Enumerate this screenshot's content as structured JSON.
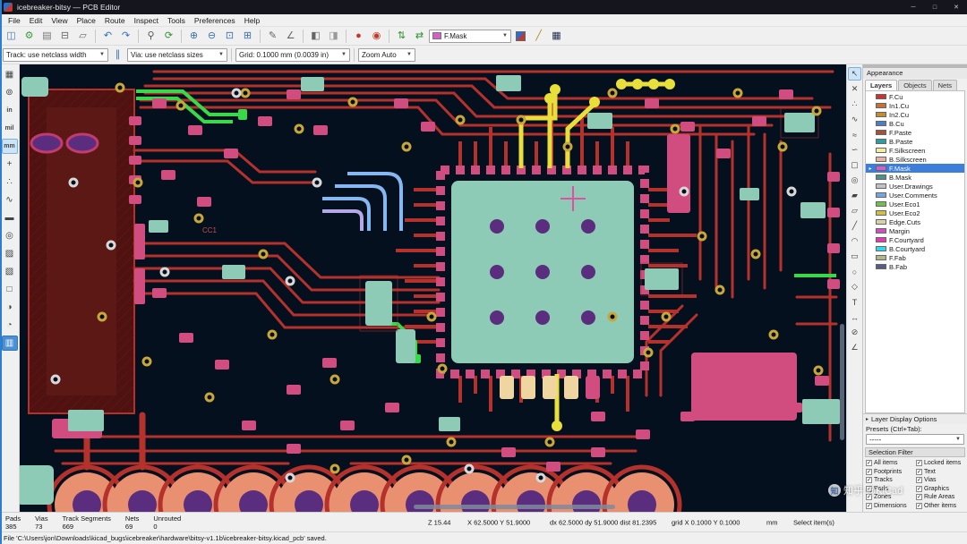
{
  "window": {
    "title": "icebreaker-bitsy — PCB Editor",
    "controls": {
      "minimize": "─",
      "maximize": "□",
      "close": "✕"
    }
  },
  "menu": {
    "items": [
      "File",
      "Edit",
      "View",
      "Place",
      "Route",
      "Inspect",
      "Tools",
      "Preferences",
      "Help"
    ]
  },
  "toolbar_top": {
    "items": [
      {
        "type": "btn",
        "name": "save",
        "icon": "save-icon",
        "glyph": "◫",
        "color": "#4a7ab5"
      },
      {
        "type": "btn",
        "name": "board-setup",
        "icon": "board-setup-gear-icon",
        "glyph": "⚙",
        "color": "#3f9b3f"
      },
      {
        "type": "btn",
        "name": "page-settings",
        "icon": "page-settings-icon",
        "glyph": "▤",
        "color": "#777777"
      },
      {
        "type": "btn",
        "name": "print",
        "icon": "printer-icon",
        "glyph": "⊟",
        "color": "#666666"
      },
      {
        "type": "btn",
        "name": "plot",
        "icon": "plot-icon",
        "glyph": "▱",
        "color": "#666666"
      },
      {
        "type": "sep"
      },
      {
        "type": "btn",
        "name": "undo",
        "icon": "undo-icon",
        "glyph": "↶",
        "color": "#2f6fb5"
      },
      {
        "type": "btn",
        "name": "redo",
        "icon": "redo-icon",
        "glyph": "↷",
        "color": "#2f6fb5"
      },
      {
        "type": "sep"
      },
      {
        "type": "btn",
        "name": "find",
        "icon": "search-icon",
        "glyph": "⚲",
        "color": "#555555"
      },
      {
        "type": "btn",
        "name": "refresh",
        "icon": "refresh-icon",
        "glyph": "⟳",
        "color": "#2f8f2f"
      },
      {
        "type": "sep"
      },
      {
        "type": "btn",
        "name": "zoom-in",
        "icon": "zoom-in-icon",
        "glyph": "⊕",
        "color": "#3a6fb0"
      },
      {
        "type": "btn",
        "name": "zoom-out",
        "icon": "zoom-out-icon",
        "glyph": "⊖",
        "color": "#3a6fb0"
      },
      {
        "type": "btn",
        "name": "zoom-fit",
        "icon": "zoom-fit-icon",
        "glyph": "⊡",
        "color": "#3a6fb0"
      },
      {
        "type": "btn",
        "name": "zoom-selection",
        "icon": "zoom-selection-icon",
        "glyph": "⊞",
        "color": "#3a6fb0"
      },
      {
        "type": "sep"
      },
      {
        "type": "btn",
        "name": "edit-properties",
        "icon": "pencil-icon",
        "glyph": "✎",
        "color": "#666666"
      },
      {
        "type": "btn",
        "name": "measure",
        "icon": "ruler-icon",
        "glyph": "∠",
        "color": "#666666"
      },
      {
        "type": "sep"
      },
      {
        "type": "btn",
        "name": "lock",
        "icon": "lock-icon",
        "glyph": "◧",
        "color": "#666666"
      },
      {
        "type": "btn",
        "name": "unlock",
        "icon": "unlock-icon",
        "glyph": "◨",
        "color": "#999999"
      },
      {
        "type": "sep"
      },
      {
        "type": "btn",
        "name": "drc",
        "icon": "drc-bug-icon",
        "glyph": "●",
        "color": "#c0392b"
      },
      {
        "type": "btn",
        "name": "footprint-checks",
        "icon": "footprint-check-icon",
        "glyph": "◉",
        "color": "#c0392b"
      },
      {
        "type": "sep"
      },
      {
        "type": "btn",
        "name": "update-pcb",
        "icon": "update-pcb-icon",
        "glyph": "⇅",
        "color": "#2f8f2f"
      },
      {
        "type": "btn",
        "name": "sync-schematic",
        "icon": "sync-icon",
        "glyph": "⇄",
        "color": "#2f8f2f"
      },
      {
        "type": "layer-select"
      },
      {
        "type": "layer-pair"
      },
      {
        "type": "btn",
        "name": "highlight-net",
        "icon": "highlight-net-icon",
        "glyph": "╱",
        "color": "#b08820"
      },
      {
        "type": "btn",
        "name": "net-inspector",
        "icon": "net-inspector-icon",
        "glyph": "▦",
        "color": "#203050"
      }
    ],
    "layer_selector": {
      "label": "F.Mask",
      "swatch": "#D35FC8"
    }
  },
  "toolbar_second": {
    "track": "Track: use netclass width",
    "via": "Via: use netclass sizes",
    "grid": "Grid: 0.1000 mm (0.0039 in)",
    "zoom": "Zoom Auto"
  },
  "left_toolbar": {
    "items": [
      {
        "name": "toggle-grid",
        "icon": "grid-icon",
        "glyph": "▦"
      },
      {
        "name": "polar-coordinates",
        "icon": "polar-icon",
        "glyph": "⊚"
      },
      {
        "name": "units-inches",
        "icon": "inches-label",
        "glyph": "in",
        "text": true
      },
      {
        "name": "units-mils",
        "icon": "mils-label",
        "glyph": "mil",
        "text": true
      },
      {
        "name": "units-mm",
        "icon": "mm-label",
        "glyph": "mm",
        "text": true,
        "active": true
      },
      {
        "name": "crosshair-cursor",
        "icon": "crosshair-icon",
        "glyph": "+"
      },
      {
        "name": "show-ratsnest",
        "icon": "ratsnest-icon",
        "glyph": "∴"
      },
      {
        "name": "curved-ratsnest",
        "icon": "curved-ratsnest-icon",
        "glyph": "∿"
      },
      {
        "name": "track-display-mode",
        "icon": "track-outline-icon",
        "glyph": "▬"
      },
      {
        "name": "via-display-mode",
        "icon": "via-outline-icon",
        "glyph": "◎"
      },
      {
        "name": "zone-fill-mode",
        "icon": "zone-fill-icon",
        "glyph": "▨"
      },
      {
        "name": "zone-outline-mode",
        "icon": "zone-outline-icon",
        "glyph": "▧"
      },
      {
        "name": "pad-display-mode",
        "icon": "pad-outline-icon",
        "glyph": "□"
      },
      {
        "name": "high-contrast-mode",
        "icon": "contrast-icon",
        "glyph": "◑"
      },
      {
        "name": "inactive-layer-dim",
        "icon": "dim-layers-icon",
        "glyph": "◔"
      },
      {
        "name": "appearance-manager",
        "icon": "appearance-icon",
        "glyph": "▥",
        "strong": true
      }
    ]
  },
  "right_toolbar": {
    "items": [
      {
        "name": "select-tool",
        "icon": "cursor-arrow-icon",
        "glyph": "↖",
        "active": true
      },
      {
        "name": "ratsnest-tool",
        "icon": "ratsnest-line-icon",
        "glyph": "✕"
      },
      {
        "name": "highlight-net-tool",
        "icon": "highlight-icon",
        "glyph": "∴"
      },
      {
        "name": "route-tracks",
        "icon": "route-icon",
        "glyph": "∿"
      },
      {
        "name": "route-diff-pair",
        "icon": "diff-pair-icon",
        "glyph": "≈"
      },
      {
        "name": "tune-track-length",
        "icon": "tune-length-icon",
        "glyph": "∽"
      },
      {
        "name": "add-footprint",
        "icon": "footprint-icon",
        "glyph": "▢"
      },
      {
        "name": "add-via",
        "icon": "via-icon",
        "glyph": "◎"
      },
      {
        "name": "add-zone",
        "icon": "zone-icon",
        "glyph": "▰"
      },
      {
        "name": "add-rule-area",
        "icon": "rule-area-icon",
        "glyph": "▱"
      },
      {
        "name": "draw-line",
        "icon": "line-icon",
        "glyph": "╱"
      },
      {
        "name": "draw-arc",
        "icon": "arc-icon",
        "glyph": "◠"
      },
      {
        "name": "draw-rectangle",
        "icon": "rectangle-icon",
        "glyph": "▭"
      },
      {
        "name": "draw-circle",
        "icon": "circle-icon",
        "glyph": "○"
      },
      {
        "name": "draw-polygon",
        "icon": "polygon-icon",
        "glyph": "◇"
      },
      {
        "name": "add-text",
        "icon": "text-icon",
        "glyph": "T"
      },
      {
        "name": "add-dimension",
        "icon": "dimension-icon",
        "glyph": "↔"
      },
      {
        "name": "delete-tool",
        "icon": "delete-icon",
        "glyph": "⊘"
      },
      {
        "name": "measure-tool",
        "icon": "measure-icon",
        "glyph": "∠"
      }
    ]
  },
  "appearance": {
    "title": "Appearance",
    "tabs": [
      "Layers",
      "Objects",
      "Nets"
    ],
    "active_layer": "F.Mask",
    "layers": [
      {
        "name": "F.Cu",
        "color": "#C83434"
      },
      {
        "name": "In1.Cu",
        "color": "#C87137"
      },
      {
        "name": "In2.Cu",
        "color": "#C28B32"
      },
      {
        "name": "B.Cu",
        "color": "#4D7FC4"
      },
      {
        "name": "F.Paste",
        "color": "#A3533B"
      },
      {
        "name": "B.Paste",
        "color": "#2F9E9E"
      },
      {
        "name": "F.Silkscreen",
        "color": "#F2EDA1"
      },
      {
        "name": "B.Silkscreen",
        "color": "#E8B2A7"
      },
      {
        "name": "F.Mask",
        "color": "#D35FC8"
      },
      {
        "name": "B.Mask",
        "color": "#4C8F8F"
      },
      {
        "name": "User.Drawings",
        "color": "#C2C2C2"
      },
      {
        "name": "User.Comments",
        "color": "#76A5DB"
      },
      {
        "name": "User.Eco1",
        "color": "#72BE4E"
      },
      {
        "name": "User.Eco2",
        "color": "#CFC04A"
      },
      {
        "name": "Edge.Cuts",
        "color": "#D8D2A8"
      },
      {
        "name": "Margin",
        "color": "#D24FC0"
      },
      {
        "name": "F.Courtyard",
        "color": "#E23BB0"
      },
      {
        "name": "B.Courtyard",
        "color": "#30D8E8"
      },
      {
        "name": "F.Fab",
        "color": "#B4B489"
      },
      {
        "name": "B.Fab",
        "color": "#585D84"
      }
    ],
    "layer_display_options": "Layer Display Options",
    "presets_label": "Presets (Ctrl+Tab):",
    "presets_value": "-----"
  },
  "selection_filter": {
    "title": "Selection Filter",
    "items": [
      "All items",
      "Locked items",
      "Footprints",
      "Text",
      "Tracks",
      "Vias",
      "Pads",
      "Graphics",
      "Zones",
      "Rule Areas",
      "Dimensions",
      "Other items"
    ]
  },
  "status_bar": {
    "counts": [
      {
        "label": "Pads",
        "value": "385"
      },
      {
        "label": "Vias",
        "value": "73"
      },
      {
        "label": "Track Segments",
        "value": "669"
      },
      {
        "label": "Nets",
        "value": "69"
      },
      {
        "label": "Unrouted",
        "value": "0"
      }
    ],
    "zoom": "Z 15.44",
    "xy": "X 62.5000 Y 51.9000",
    "dxy": "dx 62.5000 dy 51.9000 dist 81.2395",
    "grid": "grid X 0.1000 Y 0.1000",
    "units": "mm",
    "hint": "Select item(s)"
  },
  "message_bar": {
    "text": "File 'C:\\Users\\jon\\Downloads\\kicad_bugs\\icebreaker\\hardware\\bitsy-v1.1b\\icebreaker-bitsy.kicad_pcb' saved."
  },
  "watermark": {
    "text": "知乎 @KiCad",
    "badge": "知"
  },
  "canvas": {
    "label": "CC1"
  }
}
